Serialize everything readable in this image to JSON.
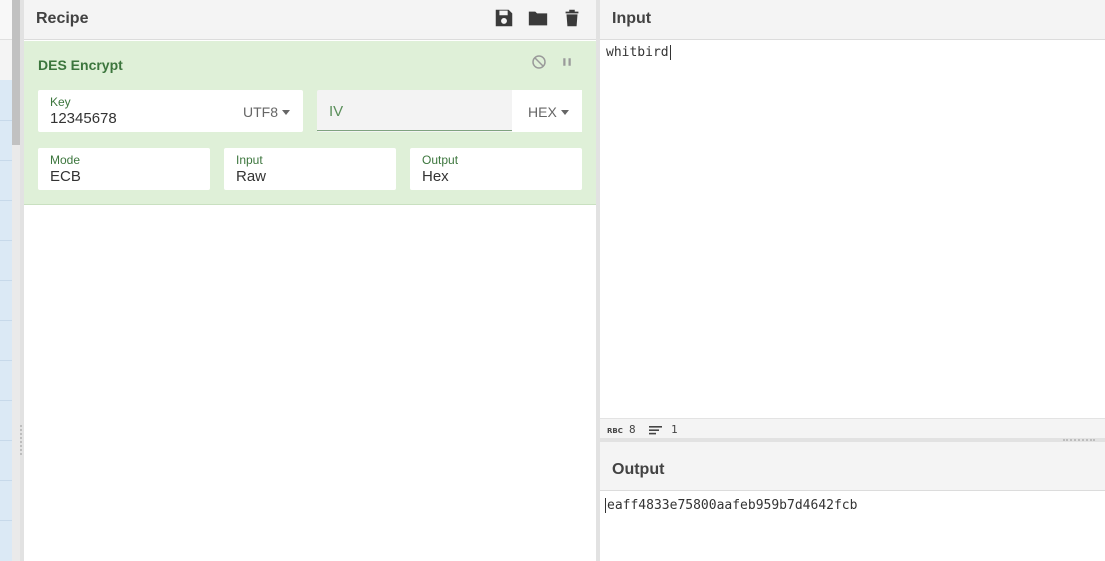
{
  "recipe": {
    "title": "Recipe",
    "icons": [
      "save-icon",
      "folder-open-icon",
      "trash-icon"
    ],
    "operation": {
      "name": "DES Encrypt",
      "controls": [
        "disable-icon",
        "pause-icon"
      ],
      "key": {
        "label": "Key",
        "value": "12345678",
        "encoding": "UTF8"
      },
      "iv": {
        "placeholder": "IV",
        "encoding": "HEX"
      },
      "mode": {
        "label": "Mode",
        "value": "ECB"
      },
      "input": {
        "label": "Input",
        "value": "Raw"
      },
      "output": {
        "label": "Output",
        "value": "Hex"
      }
    }
  },
  "input": {
    "title": "Input",
    "text": "whitbird",
    "status": {
      "length": "8",
      "lines": "1"
    }
  },
  "output": {
    "title": "Output",
    "text": "eaff4833e75800aafeb959b7d4642fcb"
  },
  "colors": {
    "accent": "#3c763d",
    "op_background": "#dff0d8",
    "header": "#f4f4f4"
  }
}
